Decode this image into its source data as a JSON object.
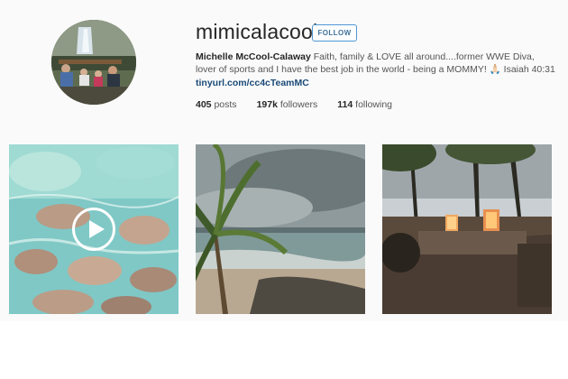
{
  "profile": {
    "username": "mimicalacool",
    "follow_label": "FOLLOW",
    "full_name": "Michelle McCool-Calaway",
    "bio_text": "Faith, family & LOVE all around....former WWE Diva, lover of sports and I have the best job in the world - being a MOMMY! 🙏🏻 Isaiah 40:31",
    "link": "tinyurl.com/cc4cTeamMC"
  },
  "stats": {
    "posts_count": "405",
    "posts_label": "posts",
    "followers_count": "197k",
    "followers_label": "followers",
    "following_count": "114",
    "following_label": "following"
  },
  "posts": [
    {
      "type": "video",
      "icon": "play-icon",
      "subject": "underwater stingrays"
    },
    {
      "type": "image",
      "subject": "palm tree beach storm"
    },
    {
      "type": "image",
      "subject": "lanterns on deck at dusk"
    }
  ],
  "colors": {
    "follow_border": "#4f97d3",
    "follow_text": "#3f729b",
    "link": "#1a4a78",
    "background": "#fafafa"
  }
}
